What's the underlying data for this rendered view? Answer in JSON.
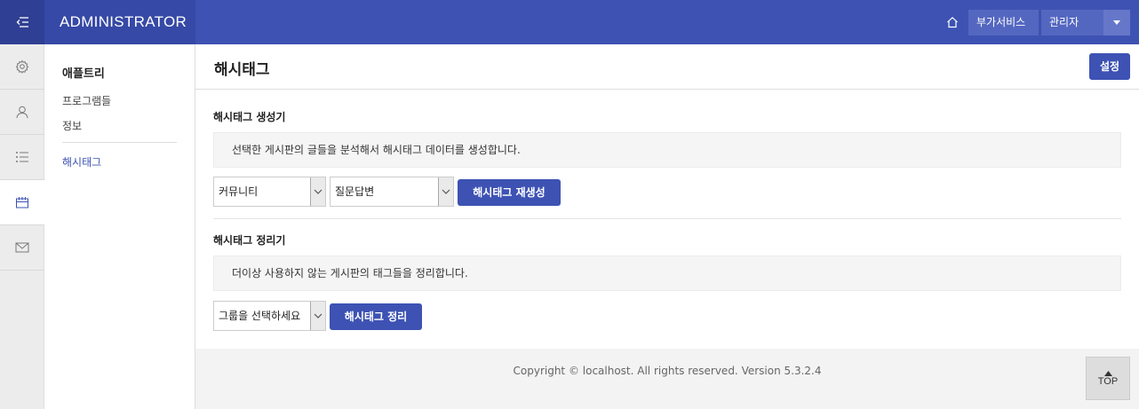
{
  "header": {
    "brand": "ADMINISTRATOR",
    "addon_label": "부가서비스",
    "admin_label": "관리자"
  },
  "rail": {
    "icons": [
      "gear-icon",
      "user-icon",
      "list-icon",
      "calendar-icon",
      "mail-icon"
    ],
    "active_index": 3
  },
  "submenu": {
    "title": "애플트리",
    "items": [
      {
        "label": "프로그램들"
      },
      {
        "label": "정보"
      },
      {
        "label": "해시태그"
      }
    ]
  },
  "page": {
    "title": "해시태그",
    "settings_label": "설정"
  },
  "generator": {
    "title": "해시태그 생성기",
    "description": "선택한 게시판의 글들을 분석해서 해시태그 데이터를 생성합니다.",
    "select1_value": "커뮤니티",
    "select2_value": "질문답변",
    "button_label": "해시태그 재생성"
  },
  "cleanup": {
    "title": "해시태그 정리기",
    "description": "더이상 사용하지 않는 게시판의 태그들을 정리합니다.",
    "select_value": "그룹을 선택하세요",
    "button_label": "해시태그 정리"
  },
  "footer": {
    "copyright": "Copyright © localhost. All rights reserved. Version 5.3.2.4",
    "top_label": "TOP"
  },
  "colors": {
    "primary": "#3d52b3",
    "primary_dark": "#2f3f93"
  }
}
